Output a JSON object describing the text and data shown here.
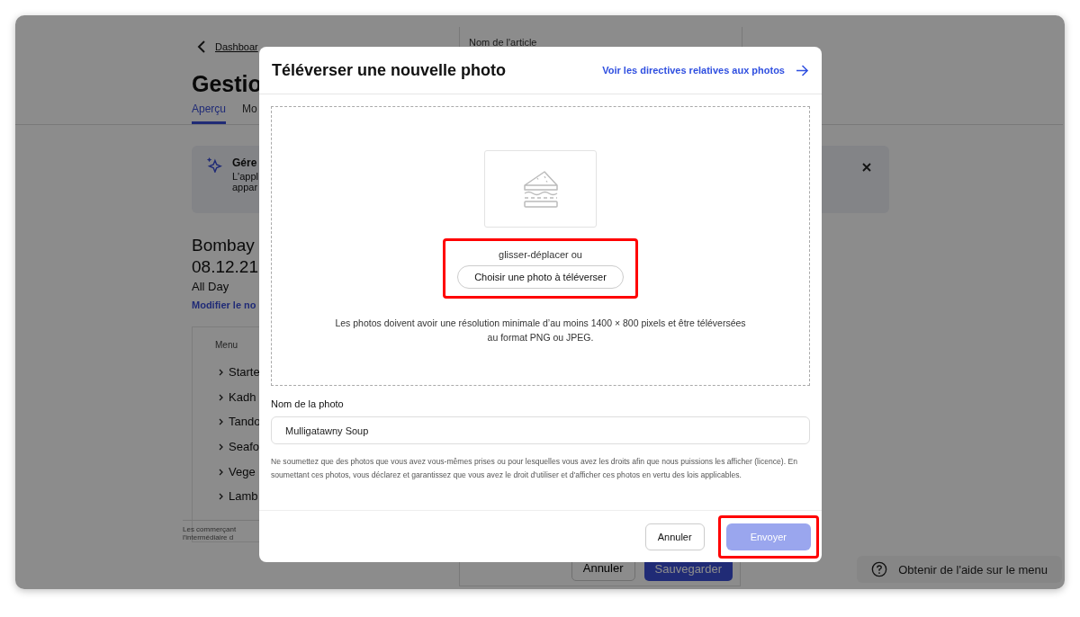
{
  "page": {
    "back_link": "Dashboar",
    "title": "Gestio",
    "tabs": [
      {
        "label": "Aperçu",
        "selected": true
      },
      {
        "label": "Mo",
        "selected": false
      }
    ],
    "banner": {
      "title": "Gére",
      "lines": [
        "L'appl",
        "appar"
      ]
    },
    "menu_name": "Bombay",
    "date": "08.12.21",
    "service": "All Day",
    "rename_link": "Modifier le no",
    "menu_section": {
      "heading": "Menu",
      "items": [
        "Starte",
        "Kadh",
        "Tando",
        "Seafo",
        "Vege",
        "Lamb"
      ]
    },
    "footer_lines": [
      "Les commerçant",
      "l'intermédiaire d"
    ],
    "article_label": "Nom de l'article",
    "article_buttons": [
      {
        "label": "Annuler",
        "kind": "secondary"
      },
      {
        "label": "Sauvegarder",
        "kind": "primary"
      }
    ],
    "help_button": "Obtenir de l'aide sur le menu"
  },
  "dialog": {
    "title": "Téléverser une nouvelle photo",
    "guidelines_link": "Voir les directives relatives aux photos",
    "dropzone": {
      "hint": "glisser-déplacer ou",
      "button": "Choisir une photo à téléverser",
      "highlighted": true,
      "requirements": "Les photos doivent avoir une résolution minimale d’au moins 1400 × 800 pixels et être téléversées au format PNG ou JPEG."
    },
    "name_field": {
      "label": "Nom de la photo",
      "value": "Mulligatawny Soup"
    },
    "disclaimer": "Ne soumettez que des photos que vous avez vous-mêmes prises ou pour lesquelles vous avez les droits afin que nous puissions les afficher (licence). En soumettant ces photos, vous déclarez et garantissez que vous avez le droit d'utiliser et d'afficher ces photos en vertu des lois applicables.",
    "buttons": [
      {
        "label": "Annuler",
        "kind": "secondary",
        "disabled": false,
        "highlighted": false
      },
      {
        "label": "Envoyer",
        "kind": "primary",
        "disabled": true,
        "highlighted": true
      }
    ]
  }
}
